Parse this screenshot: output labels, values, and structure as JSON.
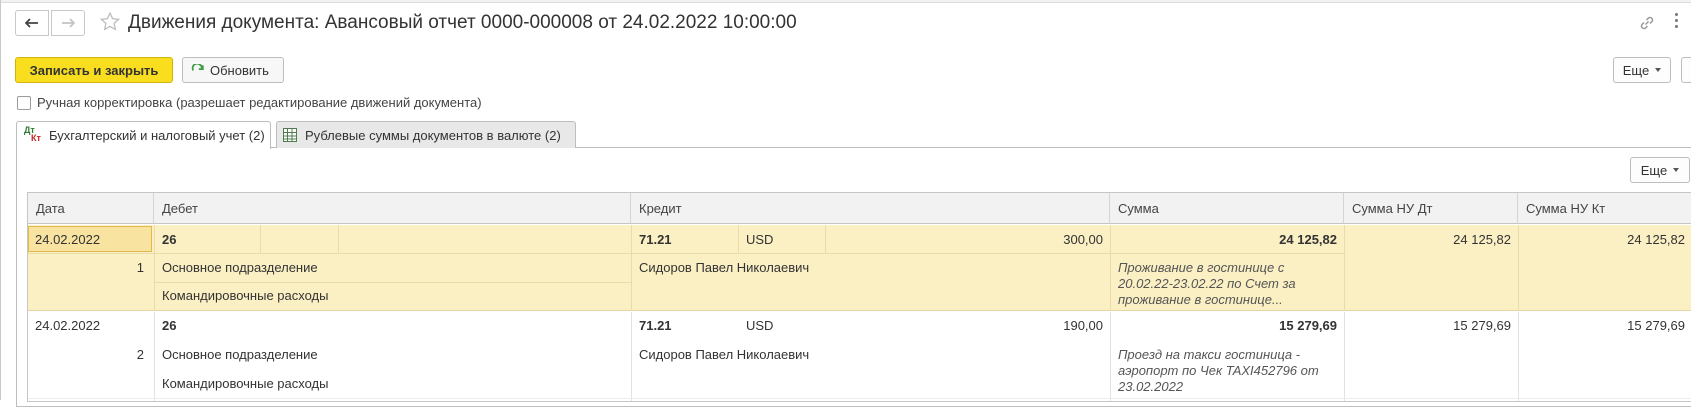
{
  "header": {
    "title": "Движения документа: Авансовый отчет 0000-000008 от 24.02.2022 10:00:00"
  },
  "toolbar": {
    "save_close_label": "Записать и закрыть",
    "refresh_label": "Обновить",
    "more_label": "Еще"
  },
  "manual_adjust_label": "Ручная корректировка (разрешает редактирование движений документа)",
  "tabs": [
    {
      "label": "Бухгалтерский и налоговый учет (2)",
      "icon": "dt-kt-icon"
    },
    {
      "label": "Рублевые суммы документов в валюте (2)",
      "icon": "table-icon"
    }
  ],
  "table": {
    "more_label": "Еще",
    "columns": [
      "Дата",
      "Дебет",
      "Кредит",
      "Сумма",
      "Сумма НУ Дт",
      "Сумма НУ Кт"
    ],
    "rows": [
      {
        "date": "24.02.2022",
        "num": "1",
        "debit_account": "26",
        "debit_sub1": "Основное подразделение",
        "debit_sub2": "Командировочные расходы",
        "credit_account": "71.21",
        "currency": "USD",
        "currency_amount": "300,00",
        "credit_sub1": "Сидоров Павел Николаевич",
        "amount": "24 125,82",
        "description": "Проживание в гостинице с 20.02.22-23.02.22 по Счет за проживание в гостинице...",
        "nu_dt": "24 125,82",
        "nu_kt": "24 125,82"
      },
      {
        "date": "24.02.2022",
        "num": "2",
        "debit_account": "26",
        "debit_sub1": "Основное подразделение",
        "debit_sub2": "Командировочные расходы",
        "credit_account": "71.21",
        "currency": "USD",
        "currency_amount": "190,00",
        "credit_sub1": "Сидоров Павел Николаевич",
        "amount": "15 279,69",
        "description": "Проезд на такси гостиница - аэропорт по Чек TAXI452796 от 23.02.2022",
        "nu_dt": "15 279,69",
        "nu_kt": "15 279,69"
      }
    ]
  },
  "colors": {
    "accent_button": "#f9de20",
    "selected_row": "#fbf0c4"
  }
}
